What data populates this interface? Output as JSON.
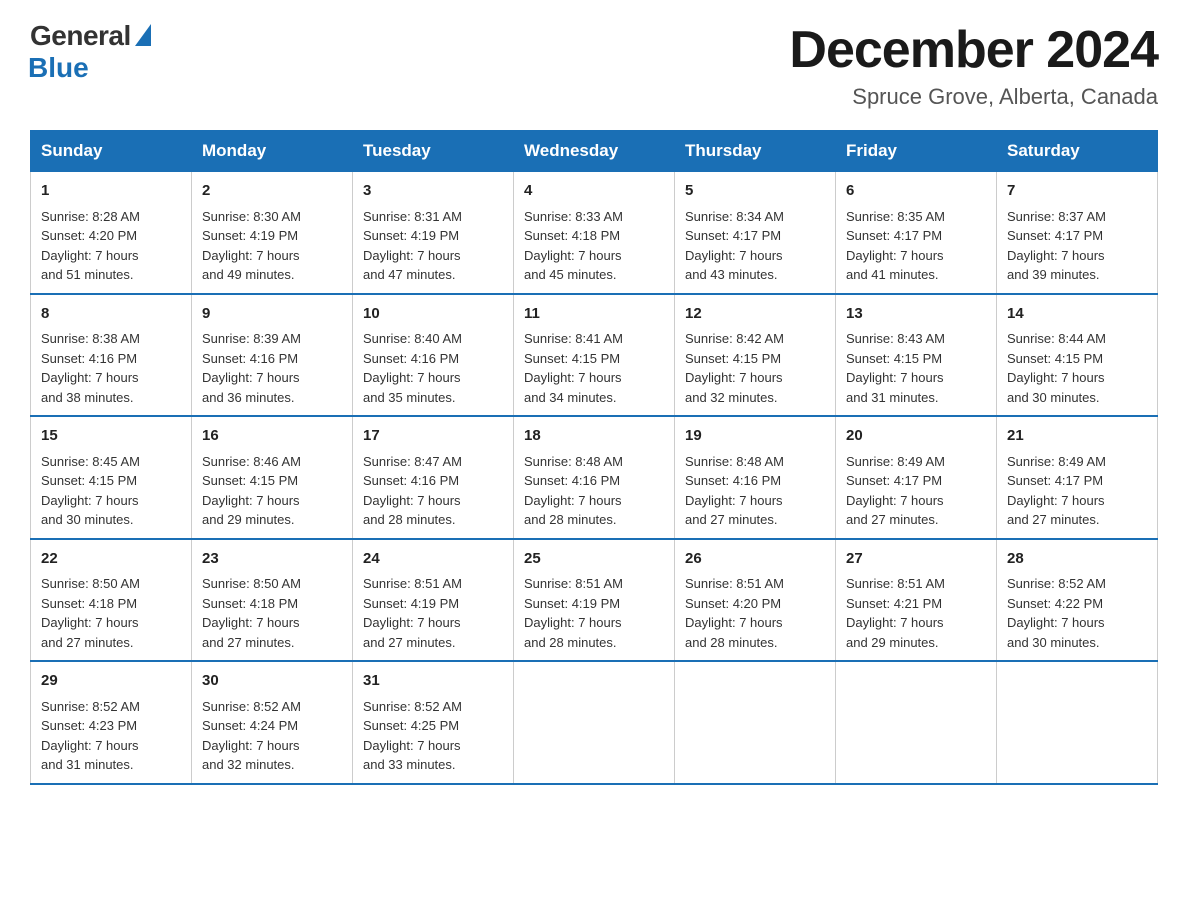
{
  "logo": {
    "general": "General",
    "blue": "Blue"
  },
  "title": "December 2024",
  "location": "Spruce Grove, Alberta, Canada",
  "headers": [
    "Sunday",
    "Monday",
    "Tuesday",
    "Wednesday",
    "Thursday",
    "Friday",
    "Saturday"
  ],
  "weeks": [
    [
      {
        "day": "1",
        "sunrise": "8:28 AM",
        "sunset": "4:20 PM",
        "daylight": "7 hours and 51 minutes."
      },
      {
        "day": "2",
        "sunrise": "8:30 AM",
        "sunset": "4:19 PM",
        "daylight": "7 hours and 49 minutes."
      },
      {
        "day": "3",
        "sunrise": "8:31 AM",
        "sunset": "4:19 PM",
        "daylight": "7 hours and 47 minutes."
      },
      {
        "day": "4",
        "sunrise": "8:33 AM",
        "sunset": "4:18 PM",
        "daylight": "7 hours and 45 minutes."
      },
      {
        "day": "5",
        "sunrise": "8:34 AM",
        "sunset": "4:17 PM",
        "daylight": "7 hours and 43 minutes."
      },
      {
        "day": "6",
        "sunrise": "8:35 AM",
        "sunset": "4:17 PM",
        "daylight": "7 hours and 41 minutes."
      },
      {
        "day": "7",
        "sunrise": "8:37 AM",
        "sunset": "4:17 PM",
        "daylight": "7 hours and 39 minutes."
      }
    ],
    [
      {
        "day": "8",
        "sunrise": "8:38 AM",
        "sunset": "4:16 PM",
        "daylight": "7 hours and 38 minutes."
      },
      {
        "day": "9",
        "sunrise": "8:39 AM",
        "sunset": "4:16 PM",
        "daylight": "7 hours and 36 minutes."
      },
      {
        "day": "10",
        "sunrise": "8:40 AM",
        "sunset": "4:16 PM",
        "daylight": "7 hours and 35 minutes."
      },
      {
        "day": "11",
        "sunrise": "8:41 AM",
        "sunset": "4:15 PM",
        "daylight": "7 hours and 34 minutes."
      },
      {
        "day": "12",
        "sunrise": "8:42 AM",
        "sunset": "4:15 PM",
        "daylight": "7 hours and 32 minutes."
      },
      {
        "day": "13",
        "sunrise": "8:43 AM",
        "sunset": "4:15 PM",
        "daylight": "7 hours and 31 minutes."
      },
      {
        "day": "14",
        "sunrise": "8:44 AM",
        "sunset": "4:15 PM",
        "daylight": "7 hours and 30 minutes."
      }
    ],
    [
      {
        "day": "15",
        "sunrise": "8:45 AM",
        "sunset": "4:15 PM",
        "daylight": "7 hours and 30 minutes."
      },
      {
        "day": "16",
        "sunrise": "8:46 AM",
        "sunset": "4:15 PM",
        "daylight": "7 hours and 29 minutes."
      },
      {
        "day": "17",
        "sunrise": "8:47 AM",
        "sunset": "4:16 PM",
        "daylight": "7 hours and 28 minutes."
      },
      {
        "day": "18",
        "sunrise": "8:48 AM",
        "sunset": "4:16 PM",
        "daylight": "7 hours and 28 minutes."
      },
      {
        "day": "19",
        "sunrise": "8:48 AM",
        "sunset": "4:16 PM",
        "daylight": "7 hours and 27 minutes."
      },
      {
        "day": "20",
        "sunrise": "8:49 AM",
        "sunset": "4:17 PM",
        "daylight": "7 hours and 27 minutes."
      },
      {
        "day": "21",
        "sunrise": "8:49 AM",
        "sunset": "4:17 PM",
        "daylight": "7 hours and 27 minutes."
      }
    ],
    [
      {
        "day": "22",
        "sunrise": "8:50 AM",
        "sunset": "4:18 PM",
        "daylight": "7 hours and 27 minutes."
      },
      {
        "day": "23",
        "sunrise": "8:50 AM",
        "sunset": "4:18 PM",
        "daylight": "7 hours and 27 minutes."
      },
      {
        "day": "24",
        "sunrise": "8:51 AM",
        "sunset": "4:19 PM",
        "daylight": "7 hours and 27 minutes."
      },
      {
        "day": "25",
        "sunrise": "8:51 AM",
        "sunset": "4:19 PM",
        "daylight": "7 hours and 28 minutes."
      },
      {
        "day": "26",
        "sunrise": "8:51 AM",
        "sunset": "4:20 PM",
        "daylight": "7 hours and 28 minutes."
      },
      {
        "day": "27",
        "sunrise": "8:51 AM",
        "sunset": "4:21 PM",
        "daylight": "7 hours and 29 minutes."
      },
      {
        "day": "28",
        "sunrise": "8:52 AM",
        "sunset": "4:22 PM",
        "daylight": "7 hours and 30 minutes."
      }
    ],
    [
      {
        "day": "29",
        "sunrise": "8:52 AM",
        "sunset": "4:23 PM",
        "daylight": "7 hours and 31 minutes."
      },
      {
        "day": "30",
        "sunrise": "8:52 AM",
        "sunset": "4:24 PM",
        "daylight": "7 hours and 32 minutes."
      },
      {
        "day": "31",
        "sunrise": "8:52 AM",
        "sunset": "4:25 PM",
        "daylight": "7 hours and 33 minutes."
      },
      null,
      null,
      null,
      null
    ]
  ],
  "labels": {
    "sunrise": "Sunrise:",
    "sunset": "Sunset:",
    "daylight": "Daylight:"
  }
}
